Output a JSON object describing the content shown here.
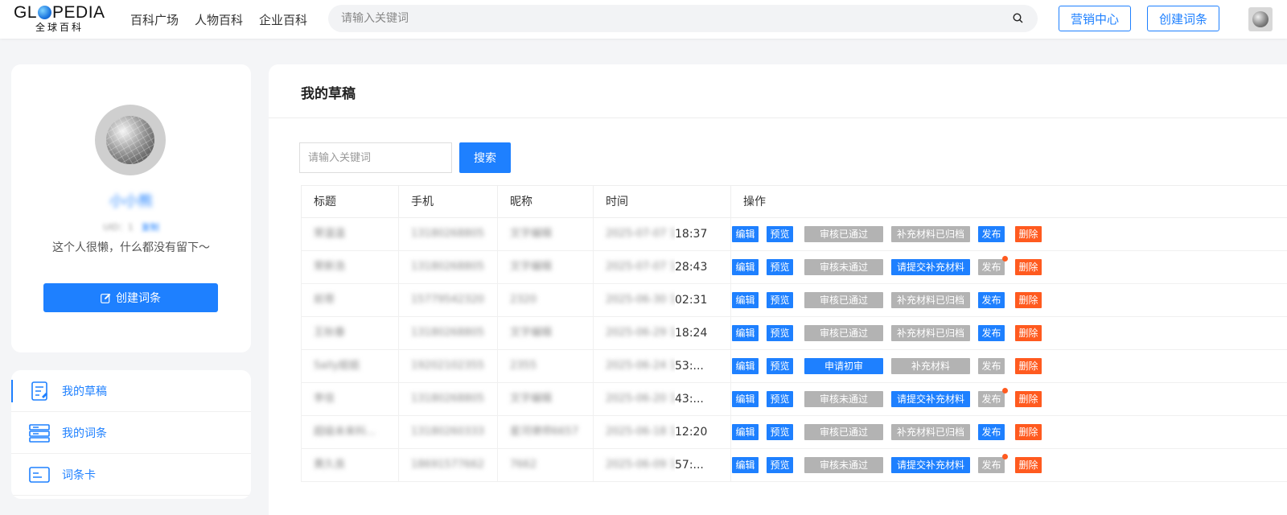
{
  "header": {
    "logo_word_left": "GL",
    "logo_word_right": "PEDIA",
    "logo_sub": "全球百科",
    "nav": [
      "百科广场",
      "人物百科",
      "企业百科"
    ],
    "search_placeholder": "请输入关键词",
    "marketing_label": "营销中心",
    "create_label": "创建词条"
  },
  "profile": {
    "username": "小小熊",
    "uid_text": "UID：1",
    "uid_link": "复制",
    "bio": "这个人很懒，什么都没有留下～",
    "create_button": "创建词条"
  },
  "menu": [
    {
      "label": "我的草稿",
      "icon": "draft-icon",
      "active": true
    },
    {
      "label": "我的词条",
      "icon": "entries-icon",
      "active": false
    },
    {
      "label": "词条卡",
      "icon": "card-icon",
      "active": false
    }
  ],
  "main": {
    "title": "我的草稿",
    "search_placeholder": "请输入关键词",
    "search_button": "搜索",
    "columns": [
      "标题",
      "手机",
      "昵称",
      "时间",
      "操作"
    ],
    "rows": [
      {
        "title": "荣温温",
        "phone": "13180268805",
        "nick": "文字编辑",
        "time_hidden": "2025-07-07 1",
        "time_visible": "18:37",
        "review": "审核已通过",
        "review_color": "gray",
        "supp": "补充材料已归档",
        "supp_color": "gray",
        "publish_color": "blue",
        "publish_dot": false
      },
      {
        "title": "荣新浩",
        "phone": "13180268805",
        "nick": "文字编辑",
        "time_hidden": "2025-07-07 1",
        "time_visible": "28:43",
        "review": "审核未通过",
        "review_color": "gray",
        "supp": "请提交补充材料",
        "supp_color": "blue",
        "publish_color": "gray",
        "publish_dot": true
      },
      {
        "title": "前哥",
        "phone": "15779542320",
        "nick": "2320",
        "time_hidden": "2025-06-30 1",
        "time_visible": "02:31",
        "review": "审核已通过",
        "review_color": "gray",
        "supp": "补充材料已归档",
        "supp_color": "gray",
        "publish_color": "blue",
        "publish_dot": false
      },
      {
        "title": "王秋春",
        "phone": "13180268805",
        "nick": "文字编辑",
        "time_hidden": "2025-06-29 1",
        "time_visible": "18:24",
        "review": "审核已通过",
        "review_color": "gray",
        "supp": "补充材料已归档",
        "supp_color": "gray",
        "publish_color": "blue",
        "publish_dot": false
      },
      {
        "title": "Sally姐姐",
        "phone": "19202102355",
        "nick": "2355",
        "time_hidden": "2025-06-24 1",
        "time_visible": "53:...",
        "review": "申请初审",
        "review_color": "blue",
        "supp": "补充材料",
        "supp_color": "gray",
        "publish_color": "gray",
        "publish_dot": false
      },
      {
        "title": "李佳",
        "phone": "13180268805",
        "nick": "文字编辑",
        "time_hidden": "2025-06-20 1",
        "time_visible": "43:...",
        "review": "审核未通过",
        "review_color": "gray",
        "supp": "请提交补充材料",
        "supp_color": "blue",
        "publish_color": "gray",
        "publish_dot": true
      },
      {
        "title": "超级未来科...",
        "phone": "13180260333",
        "nick": "星河律师6657",
        "time_hidden": "2025-06-18 1",
        "time_visible": "12:20",
        "review": "审核已通过",
        "review_color": "gray",
        "supp": "补充材料已归档",
        "supp_color": "gray",
        "publish_color": "blue",
        "publish_dot": false
      },
      {
        "title": "黄久良",
        "phone": "18691577662",
        "nick": "7662",
        "time_hidden": "2025-06-09 1",
        "time_visible": "57:...",
        "review": "审核未通过",
        "review_color": "gray",
        "supp": "请提交补充材料",
        "supp_color": "blue",
        "publish_color": "gray",
        "publish_dot": true
      }
    ],
    "edit_label": "编辑",
    "preview_label": "预览",
    "publish_label": "发布",
    "delete_label": "删除"
  },
  "colors": {
    "accent": "#1e80ff",
    "danger": "#ff5a1f",
    "muted": "#b3b3b3"
  }
}
